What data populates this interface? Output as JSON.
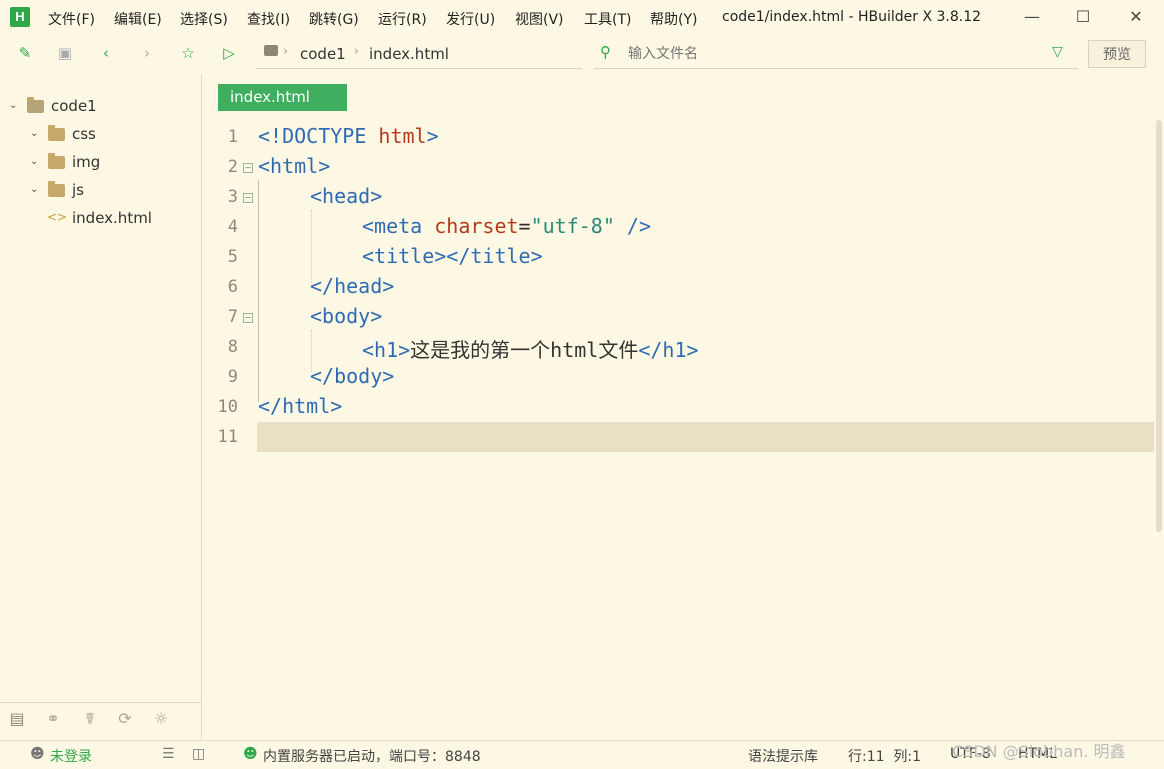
{
  "app": {
    "logo_letter": "H",
    "window_title": "code1/index.html - HBuilder X 3.8.12",
    "menus": [
      "文件(F)",
      "编辑(E)",
      "选择(S)",
      "查找(I)",
      "跳转(G)",
      "运行(R)",
      "发行(U)",
      "视图(V)",
      "工具(T)",
      "帮助(Y)"
    ]
  },
  "toolbar": {
    "breadcrumb": [
      "code1",
      "index.html"
    ],
    "search_placeholder": "输入文件名",
    "preview_label": "预览"
  },
  "sidebar": {
    "project": "code1",
    "items": [
      {
        "label": "css",
        "type": "folder"
      },
      {
        "label": "img",
        "type": "folder"
      },
      {
        "label": "js",
        "type": "folder"
      },
      {
        "label": "index.html",
        "type": "file"
      }
    ]
  },
  "editor": {
    "tab_label": "index.html",
    "line_numbers": [
      "1",
      "2",
      "3",
      "4",
      "5",
      "6",
      "7",
      "8",
      "9",
      "10",
      "11"
    ],
    "current_line": 11,
    "lines": {
      "l1": {
        "open": "<!DOCTYPE",
        "kw": " html",
        "close": ">"
      },
      "l2": "<html>",
      "l3": "<head>",
      "l4": {
        "tag": "<meta",
        "attr": " charset",
        "eq": "=",
        "val": "\"utf-8\"",
        "end": " />"
      },
      "l5": "<title></title>",
      "l6": "</head>",
      "l7": "<body>",
      "l8": {
        "open": "<h1>",
        "text": "这是我的第一个html文件",
        "close": "</h1>"
      },
      "l9": "</body>",
      "l10": "</html>"
    }
  },
  "status": {
    "login": "未登录",
    "server": "内置服务器已启动，端口号：8848",
    "syntax_lib": "语法提示库",
    "position": "行:11  列:1",
    "encoding": "UTF-8",
    "language": "HTML",
    "watermark": "CSDN @Siobhan. 明鑫"
  },
  "colors": {
    "background": "#fdf8e3",
    "accent_green": "#3fae5e",
    "tag_blue": "#2f6bb3",
    "attr_red": "#b33a1c",
    "string_teal": "#2a8a7a"
  }
}
